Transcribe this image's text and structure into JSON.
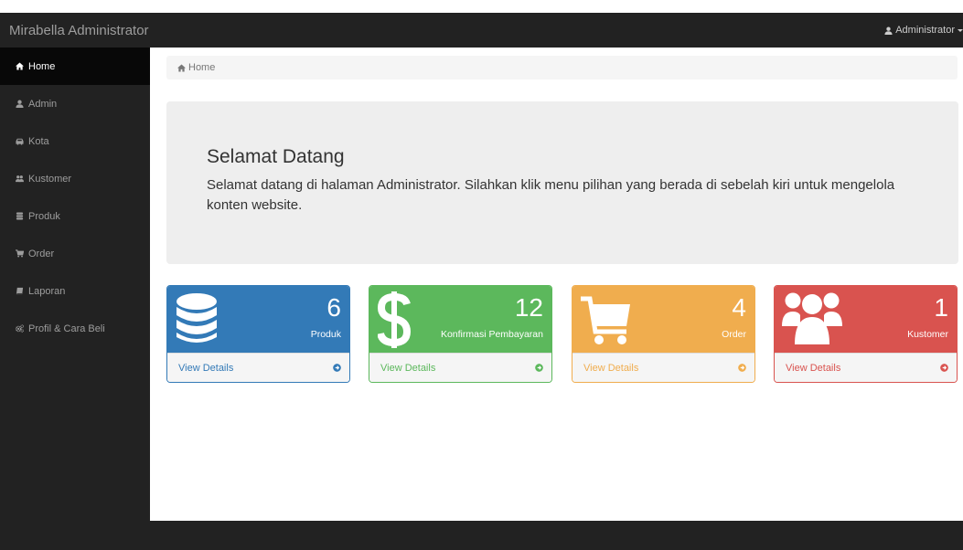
{
  "navbar": {
    "brand": "Mirabella Administrator",
    "user_label": "Administrator",
    "user_icon": "user-icon"
  },
  "sidebar": {
    "items": [
      {
        "label": "Home",
        "icon": "home-icon",
        "active": true
      },
      {
        "label": "Admin",
        "icon": "user-icon"
      },
      {
        "label": "Kota",
        "icon": "car-icon"
      },
      {
        "label": "Kustomer",
        "icon": "users-icon"
      },
      {
        "label": "Produk",
        "icon": "database-icon"
      },
      {
        "label": "Order",
        "icon": "cart-icon"
      },
      {
        "label": "Laporan",
        "icon": "book-icon"
      },
      {
        "label": "Profil & Cara Beli",
        "icon": "gears-icon"
      }
    ]
  },
  "breadcrumb": {
    "home": "Home",
    "icon": "home-icon"
  },
  "jumbotron": {
    "title": "Selamat Datang",
    "text": "Selamat datang di halaman Administrator. Silahkan klik menu pilihan yang berada di sebelah kiri untuk mengelola konten website."
  },
  "panels": [
    {
      "count": "6",
      "label": "Produk",
      "icon": "database-icon",
      "footer": "View Details",
      "color": "#337ab7"
    },
    {
      "count": "12",
      "label": "Konfirmasi Pembayaran",
      "icon": "dollar-icon",
      "footer": "View Details",
      "color": "#5cb85c"
    },
    {
      "count": "4",
      "label": "Order",
      "icon": "cart-icon",
      "footer": "View Details",
      "color": "#f0ad4e"
    },
    {
      "count": "1",
      "label": "Kustomer",
      "icon": "users-icon",
      "footer": "View Details",
      "color": "#d9534f"
    }
  ]
}
